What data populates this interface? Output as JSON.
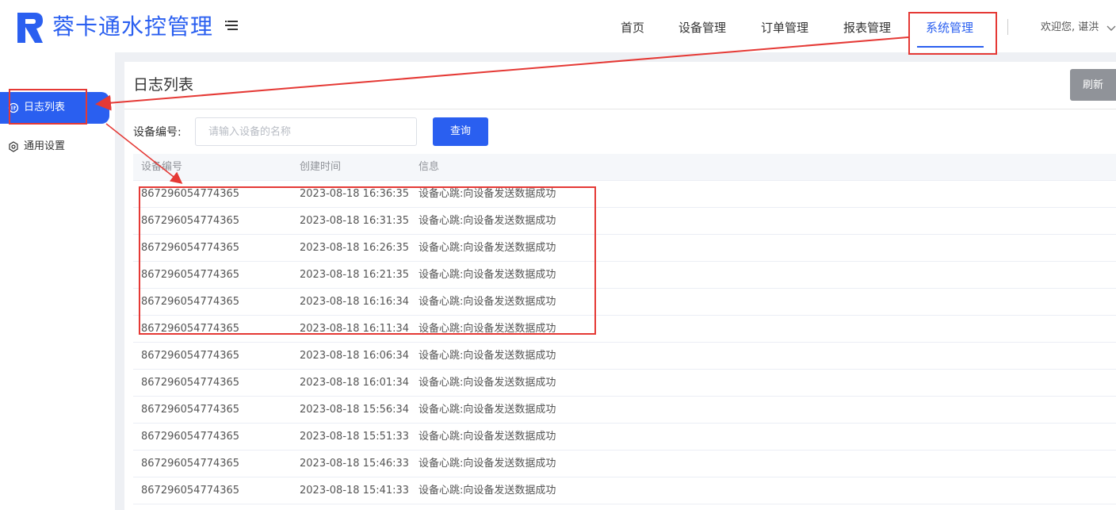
{
  "header": {
    "app_title": "蓉卡通水控管理",
    "nav": [
      {
        "label": "首页"
      },
      {
        "label": "设备管理"
      },
      {
        "label": "订单管理"
      },
      {
        "label": "报表管理"
      },
      {
        "label": "系统管理",
        "active": true
      }
    ],
    "welcome": "欢迎您, 谌洪"
  },
  "sidebar": {
    "items": [
      {
        "label": "日志列表",
        "icon": "log-icon",
        "active": true
      },
      {
        "label": "通用设置",
        "icon": "settings-icon"
      }
    ]
  },
  "main": {
    "title": "日志列表",
    "refresh_label": "刷新",
    "search": {
      "label": "设备编号:",
      "placeholder": "请输入设备的名称",
      "value": "",
      "query_label": "查询"
    },
    "table": {
      "columns": [
        "设备编号",
        "创建时间",
        "信息"
      ],
      "rows": [
        [
          "867296054774365",
          "2023-08-18 16:36:35",
          "设备心跳:向设备发送数据成功"
        ],
        [
          "867296054774365",
          "2023-08-18 16:31:35",
          "设备心跳:向设备发送数据成功"
        ],
        [
          "867296054774365",
          "2023-08-18 16:26:35",
          "设备心跳:向设备发送数据成功"
        ],
        [
          "867296054774365",
          "2023-08-18 16:21:35",
          "设备心跳:向设备发送数据成功"
        ],
        [
          "867296054774365",
          "2023-08-18 16:16:34",
          "设备心跳:向设备发送数据成功"
        ],
        [
          "867296054774365",
          "2023-08-18 16:11:34",
          "设备心跳:向设备发送数据成功"
        ],
        [
          "867296054774365",
          "2023-08-18 16:06:34",
          "设备心跳:向设备发送数据成功"
        ],
        [
          "867296054774365",
          "2023-08-18 16:01:34",
          "设备心跳:向设备发送数据成功"
        ],
        [
          "867296054774365",
          "2023-08-18 15:56:34",
          "设备心跳:向设备发送数据成功"
        ],
        [
          "867296054774365",
          "2023-08-18 15:51:33",
          "设备心跳:向设备发送数据成功"
        ],
        [
          "867296054774365",
          "2023-08-18 15:46:33",
          "设备心跳:向设备发送数据成功"
        ],
        [
          "867296054774365",
          "2023-08-18 15:41:33",
          "设备心跳:向设备发送数据成功"
        ]
      ]
    }
  },
  "colors": {
    "primary": "#2a5ff0",
    "annotation": "#e53935",
    "refresh_bg": "#909399"
  }
}
